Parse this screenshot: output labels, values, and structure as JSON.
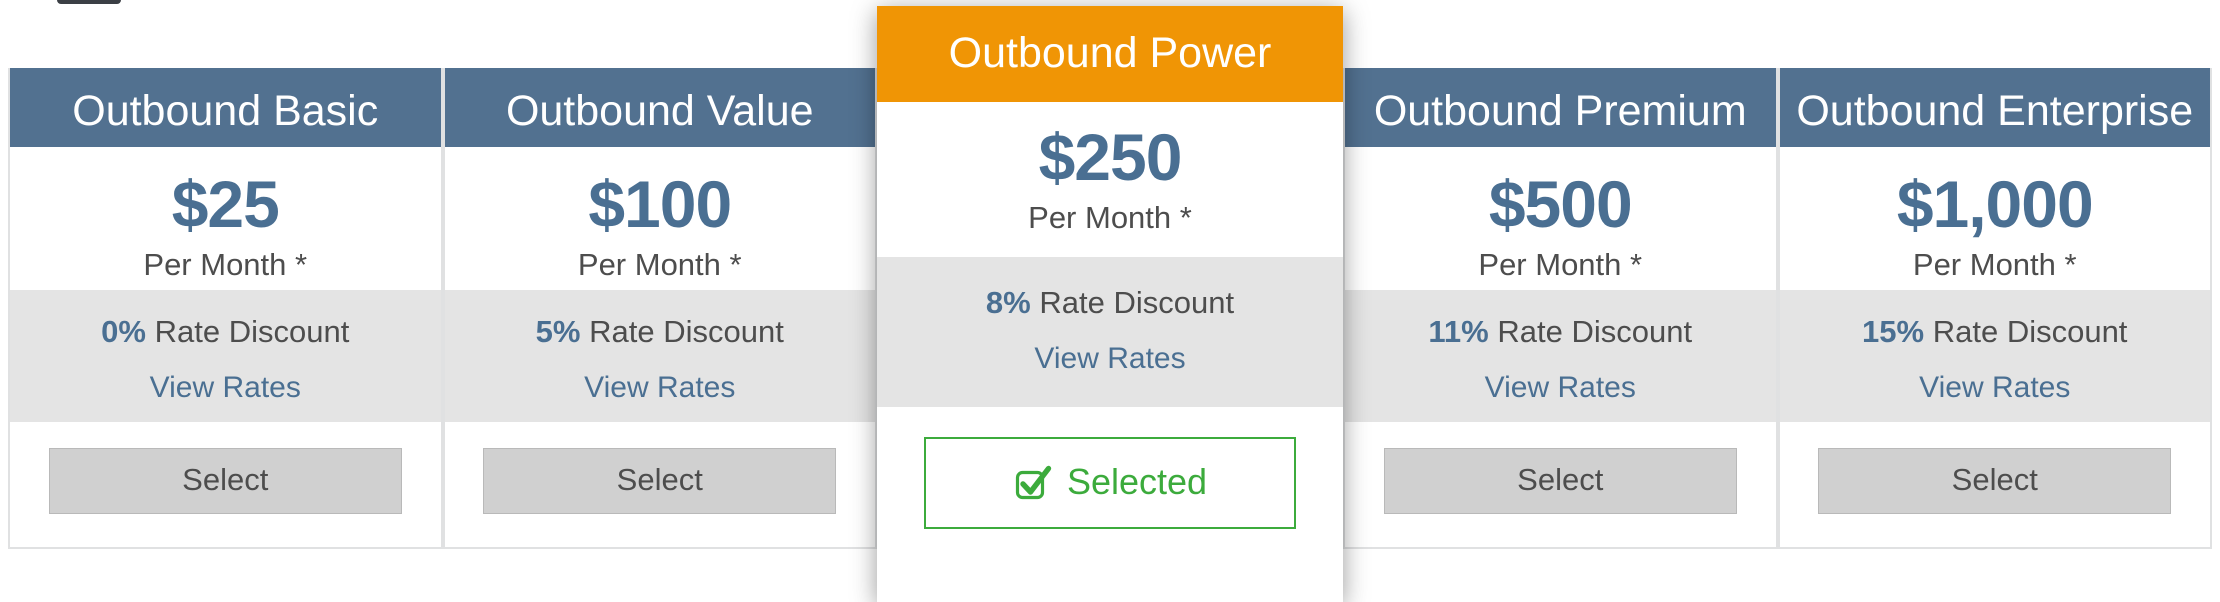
{
  "colors": {
    "header_default": "#527190",
    "header_featured": "#f09505",
    "price_text": "#4a6f92",
    "discount_band": "#e4e4e4",
    "selected_green": "#3cab3c",
    "select_button_bg": "#d0d0d0"
  },
  "labels": {
    "period": "Per Month *",
    "discount_suffix": "Rate Discount",
    "view_rates": "View Rates",
    "select": "Select",
    "selected": "Selected"
  },
  "icons": {
    "checkbox_checked": "checkbox-checked-icon"
  },
  "plans": [
    {
      "name": "Outbound Basic",
      "price": "$25",
      "period": "Per Month *",
      "discount_pct": "0%",
      "discount_suffix": "Rate Discount",
      "view_rates": "View Rates",
      "action_label": "Select",
      "featured": false,
      "selected": false
    },
    {
      "name": "Outbound Value",
      "price": "$100",
      "period": "Per Month *",
      "discount_pct": "5%",
      "discount_suffix": "Rate Discount",
      "view_rates": "View Rates",
      "action_label": "Select",
      "featured": false,
      "selected": false
    },
    {
      "name": "Outbound Power",
      "price": "$250",
      "period": "Per Month *",
      "discount_pct": "8%",
      "discount_suffix": "Rate Discount",
      "view_rates": "View Rates",
      "action_label": "Selected",
      "featured": true,
      "selected": true
    },
    {
      "name": "Outbound Premium",
      "price": "$500",
      "period": "Per Month *",
      "discount_pct": "11%",
      "discount_suffix": "Rate Discount",
      "view_rates": "View Rates",
      "action_label": "Select",
      "featured": false,
      "selected": false
    },
    {
      "name": "Outbound Enterprise",
      "price": "$1,000",
      "period": "Per Month *",
      "discount_pct": "15%",
      "discount_suffix": "Rate Discount",
      "view_rates": "View Rates",
      "action_label": "Select",
      "featured": false,
      "selected": false
    }
  ]
}
